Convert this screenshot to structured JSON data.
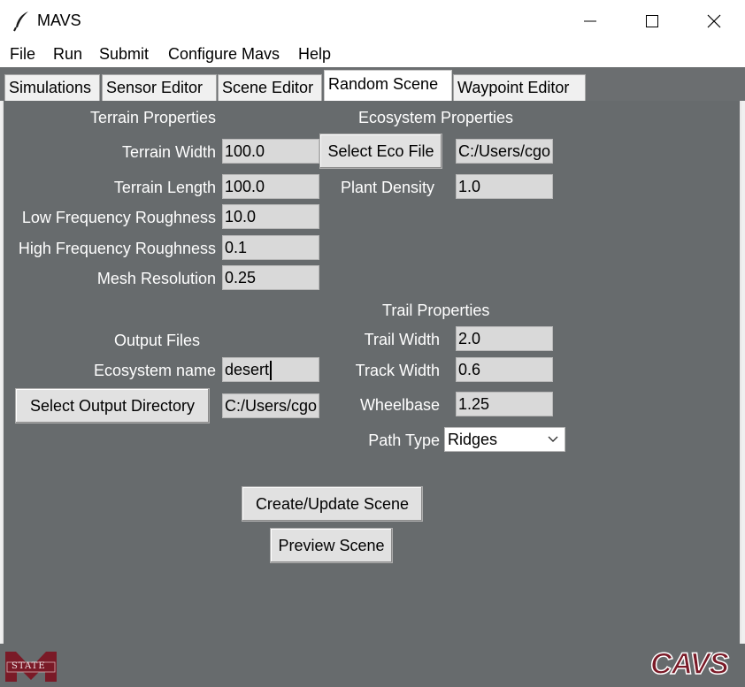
{
  "window": {
    "title": "MAVS"
  },
  "menu": [
    "File",
    "Run",
    "Submit",
    "Configure Mavs",
    "Help"
  ],
  "tabs": [
    "Simulations",
    "Sensor Editor",
    "Scene Editor",
    "Random Scene",
    "Waypoint Editor"
  ],
  "active_tab": "Random Scene",
  "terrain": {
    "heading": "Terrain Properties",
    "width_label": "Terrain Width",
    "width_value": "100.0",
    "length_label": "Terrain Length",
    "length_value": "100.0",
    "low_freq_label": "Low Frequency Roughness",
    "low_freq_value": "10.0",
    "high_freq_label": "High Frequency Roughness",
    "high_freq_value": "0.1",
    "mesh_label": "Mesh Resolution",
    "mesh_value": "0.25"
  },
  "ecosystem": {
    "heading": "Ecosystem Properties",
    "select_button": "Select Eco File",
    "file_value": "C:/Users/cgo",
    "density_label": "Plant Density",
    "density_value": "1.0"
  },
  "output": {
    "heading": "Output Files",
    "name_label": "Ecosystem name",
    "name_value": "desert",
    "dir_button": "Select Output Directory",
    "dir_value": "C:/Users/cgo"
  },
  "trail": {
    "heading": "Trail Properties",
    "trail_width_label": "Trail Width",
    "trail_width_value": "2.0",
    "track_width_label": "Track Width",
    "track_width_value": "0.6",
    "wheelbase_label": "Wheelbase",
    "wheelbase_value": "1.25",
    "path_type_label": "Path Type",
    "path_type_value": "Ridges"
  },
  "actions": {
    "create": "Create/Update Scene",
    "preview": "Preview Scene"
  },
  "footer": {
    "left_logo": "STATE",
    "right_logo": "CAVS"
  },
  "colors": {
    "panel": "#676b6d",
    "field": "#d9d9d9",
    "button": "#e1e1e1",
    "logo_maroon": "#7a1a27"
  },
  "icons": {
    "app": "feather-icon",
    "minimize": "minimize-icon",
    "maximize": "maximize-icon",
    "close": "close-icon",
    "dropdown": "chevron-down-icon"
  }
}
